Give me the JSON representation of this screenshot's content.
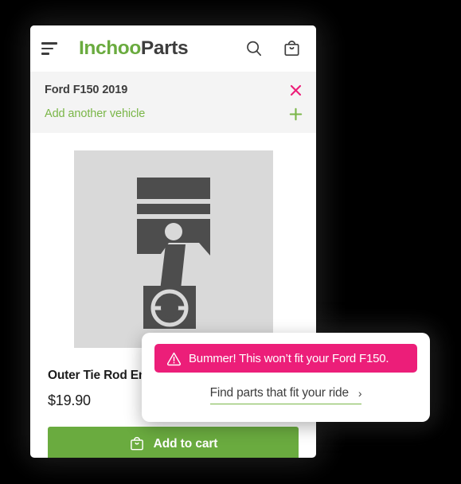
{
  "app": {
    "brand_primary": "Inchoo",
    "brand_secondary": "Parts",
    "brand_green": "#6aab3f",
    "brand_dark": "#3d3d3d",
    "accent_pink": "#ec1e79"
  },
  "appbar": {
    "menu_icon": "hamburger-menu-icon",
    "search_icon": "search-icon",
    "cart_icon": "shopping-bag-icon"
  },
  "vehicle": {
    "current_vehicle": "Ford F150 2019",
    "remove_icon": "close-x-icon",
    "add_label": "Add another vehicle",
    "add_icon": "plus-icon"
  },
  "product": {
    "image_alt": "piston-part-icon",
    "title": "Outer Tie Rod En",
    "price": "$19.90",
    "add_to_cart_label": "Add to cart",
    "add_to_cart_icon": "shopping-bag-icon"
  },
  "fitment": {
    "warning_icon": "warning-triangle-icon",
    "warning_text": "Bummer! This won’t fit your Ford F150.",
    "link_text": "Find parts that fit your ride",
    "link_chevron": "›"
  }
}
